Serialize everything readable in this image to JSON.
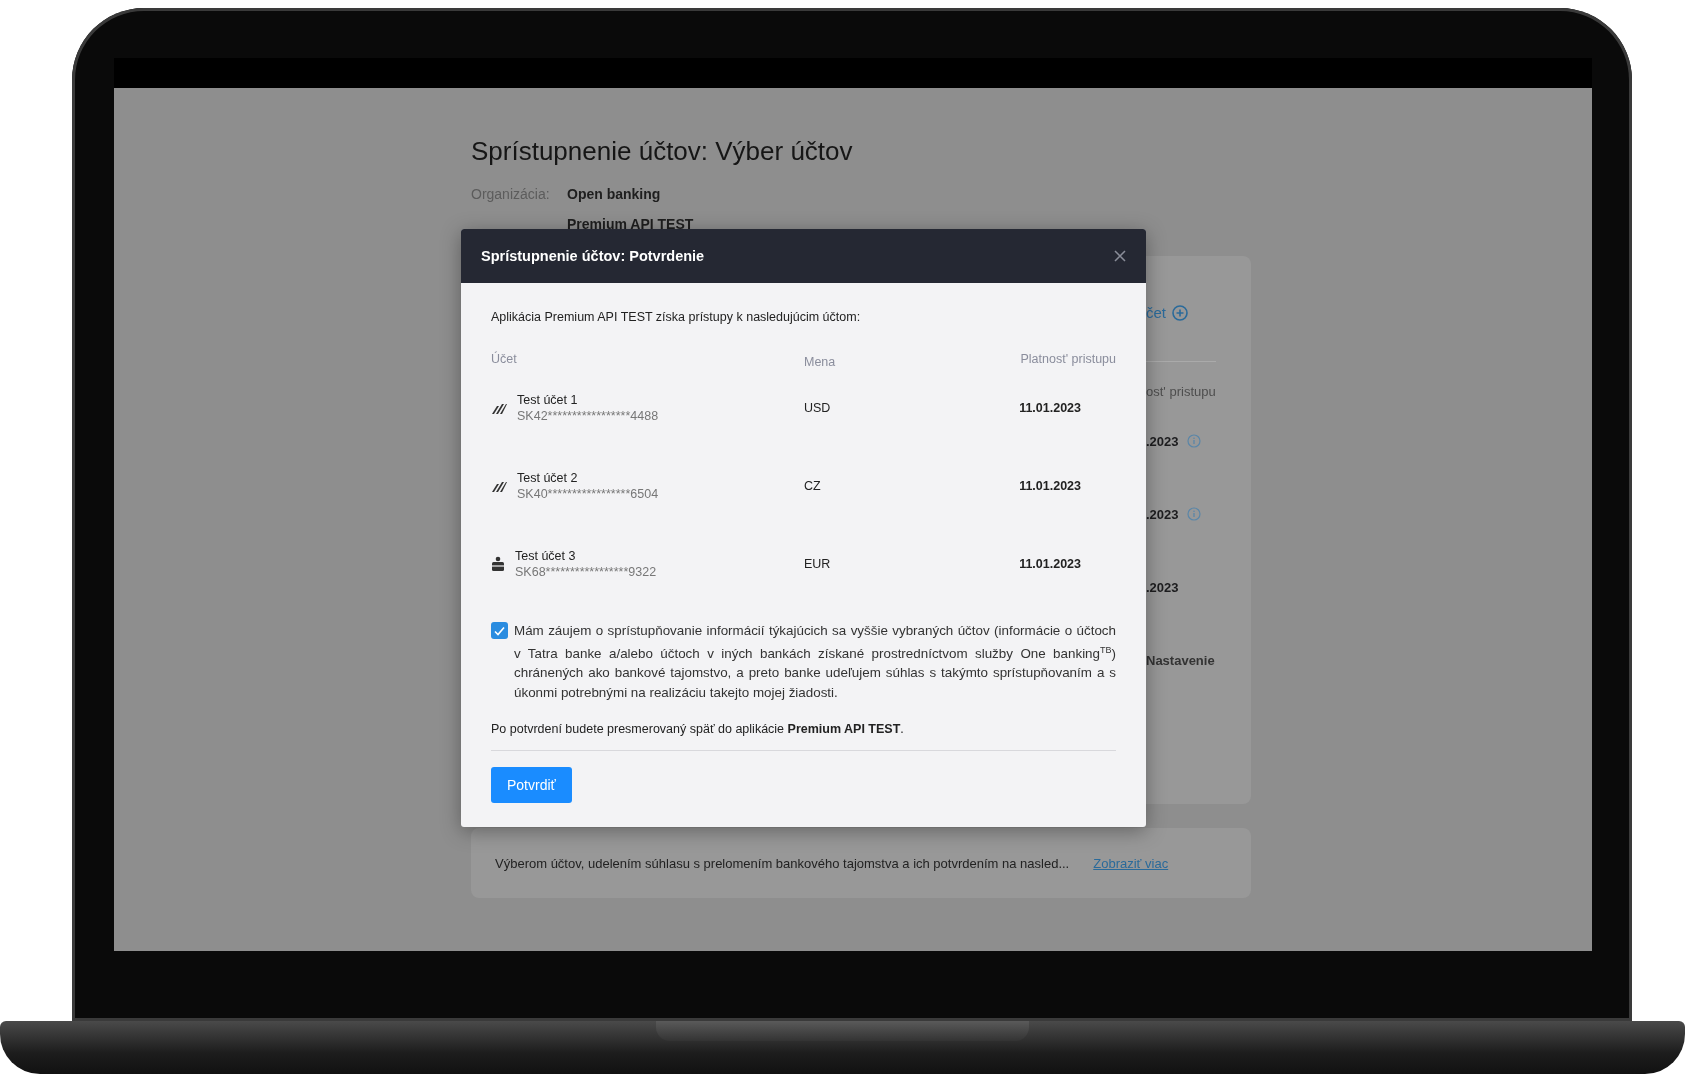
{
  "background_page": {
    "title": "Sprístupnenie účtov: Výber účtov",
    "details": [
      {
        "label": "Organizácia:",
        "value": "Open banking"
      },
      {
        "value": "Premium API TEST"
      }
    ],
    "card": {
      "add_link": "čet",
      "column_header": "ost' pristupu",
      "dates": [
        {
          "text": ".2023",
          "info": true
        },
        {
          "text": ".2023",
          "info": true
        },
        {
          "text": ".2023",
          "info": false
        }
      ],
      "settings": "Nastavenie"
    },
    "notice": {
      "text": "Výberom účtov, udelením súhlasu s prelomením bankového tajomstva a ich potvrdením na nasled...",
      "link": "Zobraziť viac"
    }
  },
  "dialog": {
    "title": "Sprístupnenie účtov: Potvrdenie",
    "intro": "Aplikácia Premium API TEST získa prístupy k nasledujúcim účtom:",
    "columns": [
      "Účet",
      "Mena",
      "Platnost' pristupu"
    ],
    "accounts": [
      {
        "kind": "stripes",
        "name": "Test účet 1",
        "iban": "SK42*****************4488",
        "currency": "USD",
        "valid_until": "11.01.2023"
      },
      {
        "kind": "stripes",
        "name": "Test účet 2",
        "iban": "SK40*****************6504",
        "currency": "CZ",
        "valid_until": "11.01.2023"
      },
      {
        "kind": "bank",
        "name": "Test účet 3",
        "iban": "SK68*****************9322",
        "currency": "EUR",
        "valid_until": "11.01.2023"
      }
    ],
    "consent": {
      "checked": true,
      "text": "Mám záujem o sprístupňovanie informácií týkajúcich sa vyššie vybraných účtov (informácie o účtoch v Tatra banke a/alebo účtoch v iných bankách získané prostredníctvom služby One banking$^{TB}$) chránených ako bankové tajomstvo, a preto banke udeľujem súhlas s takýmto sprístupňovaním a s úkonmi potrebnými na realizáciu takejto mojej žiadosti."
    },
    "redirect_note": "Po potvrdení budete presmerovaný späť do aplikácie **Premium API TEST**.",
    "confirm_button": "Potvrdiť"
  }
}
